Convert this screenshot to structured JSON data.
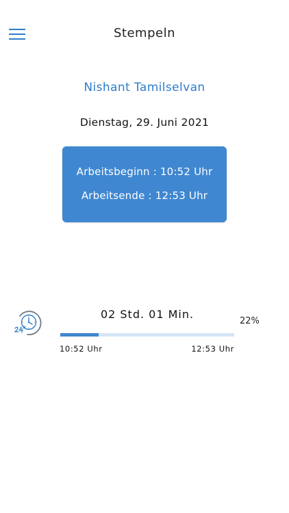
{
  "header": {
    "title": "Stempeln",
    "menu_icon": "hamburger-menu-icon"
  },
  "user": {
    "name": "Nishant Tamilselvan"
  },
  "date": "Dienstag, 29. Juni 2021",
  "time_card": {
    "start_line": "Arbeitsbeginn : 10:52 Uhr",
    "end_line": "Arbeitsende : 12:53 Uhr"
  },
  "progress": {
    "icon": "clock-24h-icon",
    "duration": "02 Std. 01 Min.",
    "percent_label": "22%",
    "fraction": 0.22,
    "start_time": "10:52 Uhr",
    "end_time": "12:53 Uhr"
  },
  "colors": {
    "accent": "#3f87d0",
    "name_text": "#2e7dc8",
    "track": "#d6e5f7"
  }
}
